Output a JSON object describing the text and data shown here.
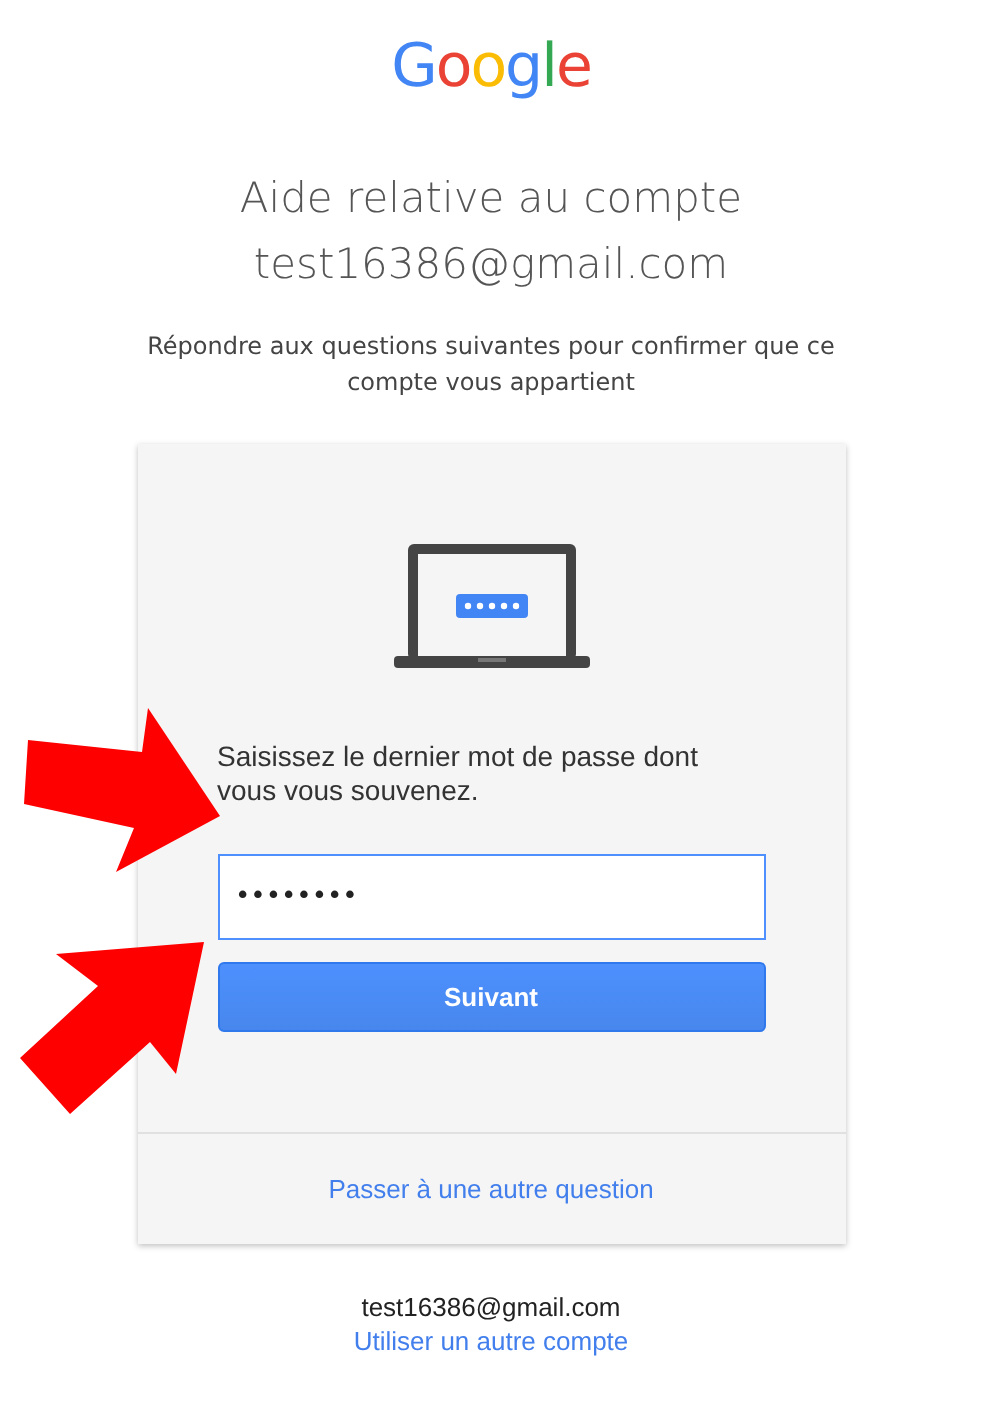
{
  "logo": {
    "text": "Google"
  },
  "title": "Aide relative au compte",
  "email_heading": "test16386@gmail.com",
  "subtitle": "Répondre aux questions suivantes pour confirmer que ce compte vous appartient",
  "card": {
    "prompt": "Saisissez le dernier mot de passe dont vous vous souvenez.",
    "password_field": {
      "value": "••••••••",
      "focused": true
    },
    "next_button": "Suivant",
    "other_question_link": "Passer à une autre question"
  },
  "footer": {
    "account_email": "test16386@gmail.com",
    "switch_account_link": "Utiliser un autre compte"
  }
}
